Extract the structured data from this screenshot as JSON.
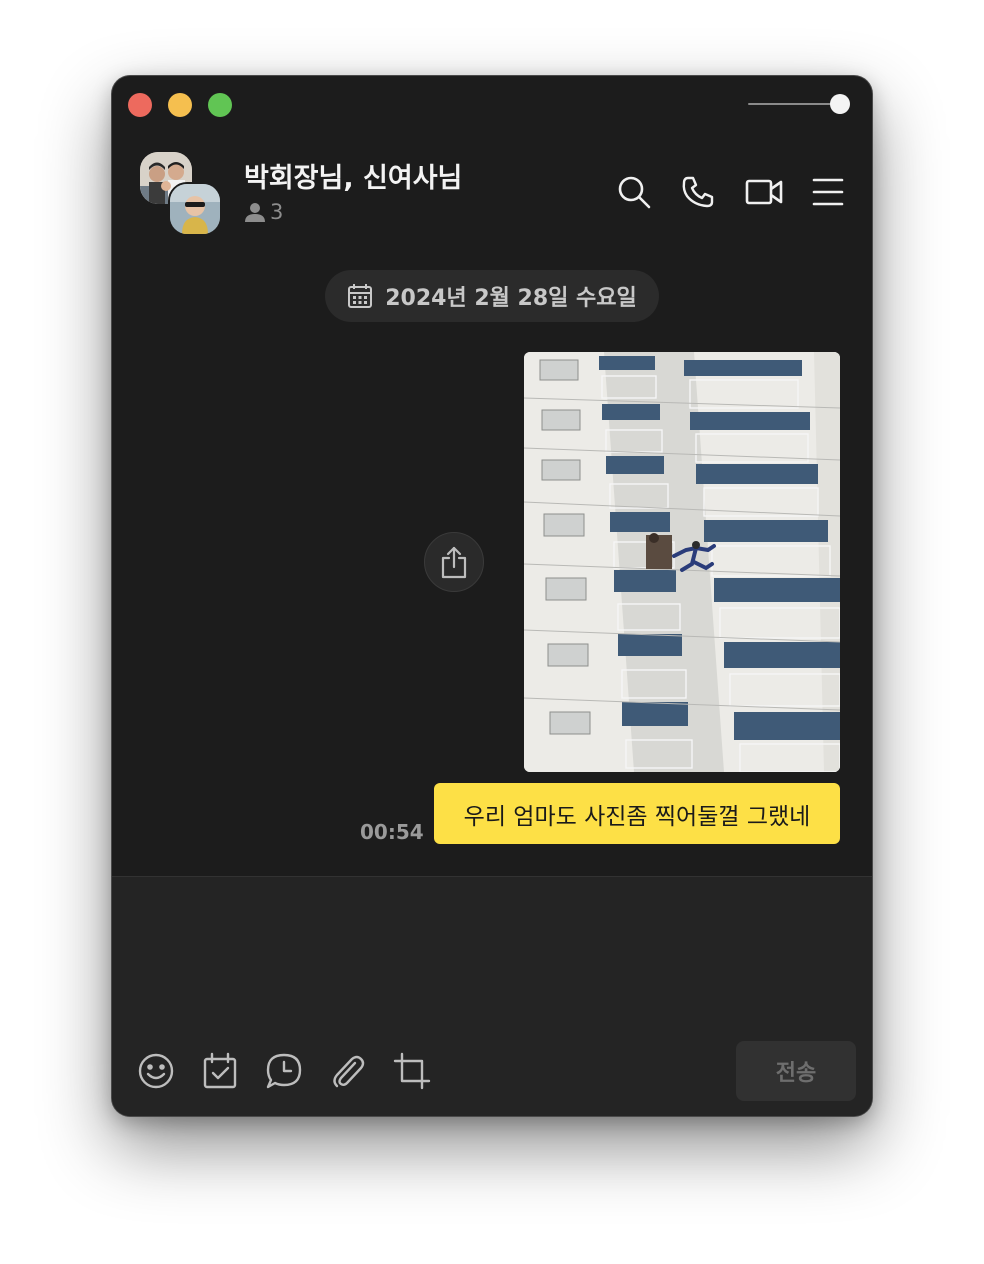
{
  "chat": {
    "title": "박회장님, 신여사님",
    "member_count": "3",
    "date_divider": "2024년 2월 28일 수요일"
  },
  "header_icons": [
    "search-icon",
    "phone-icon",
    "video-call-icon",
    "menu-icon"
  ],
  "messages": [
    {
      "type": "image",
      "sender": "me",
      "description_icon": "photo"
    },
    {
      "type": "text",
      "sender": "me",
      "text": "우리 엄마도 사진좀 찍어둘껄 그랬네",
      "time": "00:54"
    }
  ],
  "composer": {
    "placeholder": "",
    "tools": [
      "emoji-icon",
      "calendar-check-icon",
      "chat-bubble-clock-icon",
      "paperclip-icon",
      "crop-icon"
    ],
    "send_label": "전송"
  },
  "colors": {
    "window_bg": "#1c1c1c",
    "bubble_mine": "#fde046",
    "composer_bg": "#242424",
    "traffic_close": "#ed6a5e",
    "traffic_min": "#f5bf4f",
    "traffic_max": "#61c554"
  }
}
